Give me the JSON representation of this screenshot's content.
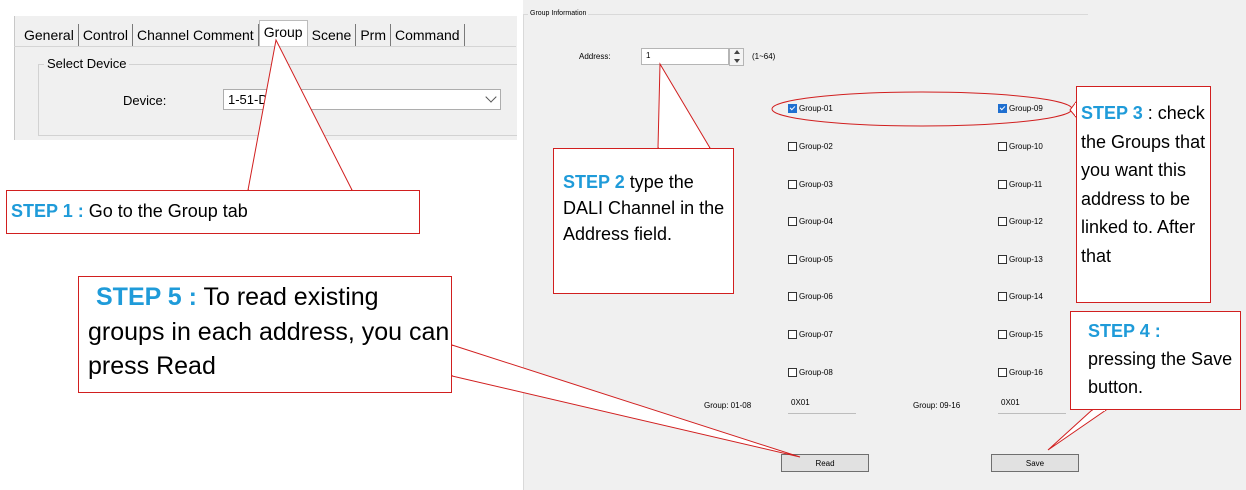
{
  "tabs": [
    "General",
    "Control",
    "Channel Comment",
    "Group",
    "Scene",
    "Prm",
    "Command"
  ],
  "active_tab": "Group",
  "select_device": {
    "legend": "Select Device",
    "device_label": "Device:",
    "device_value": "1-51-DALI"
  },
  "group_info": {
    "title": "Group Information",
    "address_label": "Address:",
    "address_value": "1",
    "address_range": "(1~64)",
    "groups_left": [
      {
        "label": "Group-01",
        "checked": true
      },
      {
        "label": "Group-02",
        "checked": false
      },
      {
        "label": "Group-03",
        "checked": false
      },
      {
        "label": "Group-04",
        "checked": false
      },
      {
        "label": "Group-05",
        "checked": false
      },
      {
        "label": "Group-06",
        "checked": false
      },
      {
        "label": "Group-07",
        "checked": false
      },
      {
        "label": "Group-08",
        "checked": false
      }
    ],
    "groups_right": [
      {
        "label": "Group-09",
        "checked": true
      },
      {
        "label": "Group-10",
        "checked": false
      },
      {
        "label": "Group-11",
        "checked": false
      },
      {
        "label": "Group-12",
        "checked": false
      },
      {
        "label": "Group-13",
        "checked": false
      },
      {
        "label": "Group-14",
        "checked": false
      },
      {
        "label": "Group-15",
        "checked": false
      },
      {
        "label": "Group-16",
        "checked": false
      }
    ],
    "mask_left_label": "Group: 01-08",
    "mask_left_value": "0X01",
    "mask_right_label": "Group: 09-16",
    "mask_right_value": "0X01",
    "read_button": "Read",
    "save_button": "Save"
  },
  "callouts": {
    "step1": {
      "step": "STEP 1 :",
      "text": " Go to the Group tab"
    },
    "step2": {
      "step": "STEP 2",
      "text": " type the DALI Channel in the Address field."
    },
    "step3": {
      "step": "STEP 3",
      "text": " : check the Groups that you want this address to be linked to. After that"
    },
    "step4": {
      "step": "STEP 4 :",
      "text": "pressing the Save button."
    },
    "step5": {
      "step": "STEP 5 :",
      "text": " To read existing groups in each address, you can press Read"
    }
  },
  "colors": {
    "callout_border": "#d11f1f",
    "step_text": "#1f9bd9",
    "checkbox_checked": "#1f6fd0"
  }
}
